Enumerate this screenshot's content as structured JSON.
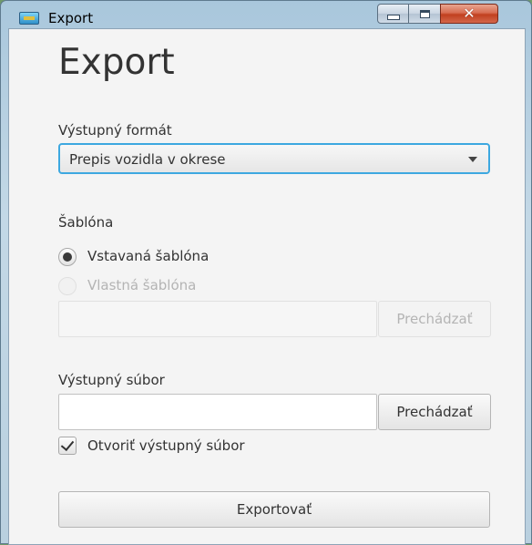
{
  "window": {
    "title": "Export"
  },
  "dialog": {
    "heading": "Export",
    "output_format": {
      "label": "Výstupný formát",
      "selected": "Prepis vozidla v okrese"
    },
    "template": {
      "label": "Šablóna",
      "options": [
        {
          "label": "Vstavaná šablóna",
          "checked": true,
          "enabled": true
        },
        {
          "label": "Vlastná šablóna",
          "checked": false,
          "enabled": false
        }
      ],
      "path_value": "",
      "browse_label": "Prechádzať"
    },
    "output_file": {
      "label": "Výstupný súbor",
      "path_value": "",
      "browse_label": "Prechádzať"
    },
    "open_output": {
      "label": "Otvoriť výstupný súbor",
      "checked": true
    },
    "export_button": "Exportovať"
  }
}
